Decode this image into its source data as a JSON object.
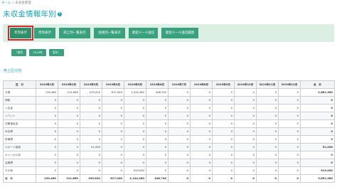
{
  "breadcrumb": {
    "home": "ホーム",
    "current": "未収金管理"
  },
  "page": {
    "title": "未収金情報年別"
  },
  "tabs": [
    {
      "label": "年別表示",
      "active": true
    },
    {
      "label": "月別表示",
      "active": false
    },
    {
      "label": "売上別一覧表示",
      "active": false
    },
    {
      "label": "会員別一覧表示",
      "active": false
    },
    {
      "label": "督促メール送信",
      "active": false
    },
    {
      "label": "督促メール送信履歴",
      "active": false
    }
  ],
  "actions": {
    "btn1": "〈前年",
    "btn2": "2019年",
    "btn3": "翌年〉"
  },
  "section": {
    "label": "売上区分別"
  },
  "table": {
    "headers": [
      "区　分",
      "2019年1月",
      "2019年2月",
      "2019年3月",
      "2019年4月",
      "2019年5月",
      "2019年6月",
      "2019年7月",
      "2019年8月",
      "2019年9月",
      "2019年10月",
      "2019年11月",
      "2019年12月",
      "合　計"
    ],
    "rows": [
      {
        "label": "月謝",
        "cells": [
          "139,460",
          "211,660",
          "239,220",
          "617,040",
          "1,225,260",
          "448,740",
          "0",
          "0",
          "0",
          "0",
          "0",
          "0",
          "2,881,380"
        ]
      },
      {
        "label": "物販",
        "cells": [
          "0",
          "0",
          "0",
          "0",
          "0",
          "0",
          "0",
          "0",
          "0",
          "0",
          "0",
          "0",
          "0"
        ]
      },
      {
        "label": "入会金",
        "cells": [
          "0",
          "0",
          "0",
          "0",
          "0",
          "0",
          "0",
          "0",
          "0",
          "0",
          "0",
          "0",
          "0"
        ]
      },
      {
        "label": "イベント",
        "cells": [
          "0",
          "0",
          "0",
          "0",
          "0",
          "0",
          "0",
          "0",
          "0",
          "0",
          "0",
          "0",
          "0"
        ]
      },
      {
        "label": "在籍保証金",
        "cells": [
          "0",
          "0",
          "0",
          "0",
          "0",
          "0",
          "0",
          "0",
          "0",
          "0",
          "0",
          "0",
          "0"
        ]
      },
      {
        "label": "年会費",
        "cells": [
          "0",
          "0",
          "0",
          "0",
          "0",
          "0",
          "0",
          "0",
          "0",
          "0",
          "0",
          "0",
          "0"
        ]
      },
      {
        "label": "設備費",
        "cells": [
          "0",
          "0",
          "0",
          "0",
          "0",
          "0",
          "0",
          "0",
          "0",
          "0",
          "0",
          "0",
          "0"
        ]
      },
      {
        "label": "スポーツ保険",
        "cells": [
          "0",
          "0",
          "51,000",
          "0",
          "0",
          "0",
          "0",
          "0",
          "0",
          "0",
          "0",
          "0",
          "51,000"
        ]
      },
      {
        "label": "キャンセル料",
        "cells": [
          "0",
          "0",
          "0",
          "0",
          "0",
          "0",
          "0",
          "0",
          "0",
          "0",
          "0",
          "0",
          "0"
        ]
      },
      {
        "label": "会員費",
        "cells": [
          "0",
          "0",
          "0",
          "0",
          "0",
          "0",
          "0",
          "0",
          "0",
          "0",
          "0",
          "0",
          "0"
        ]
      },
      {
        "label": "その他",
        "cells": [
          "0",
          "0",
          "0",
          "0",
          "919,000",
          "0",
          "0",
          "0",
          "0",
          "0",
          "0",
          "0",
          "919,000"
        ]
      }
    ],
    "total": {
      "label": "合　計",
      "cells": [
        "139,460",
        "211,660",
        "290,620",
        "617,040",
        "2,144,260",
        "448,740",
        "0",
        "0",
        "0",
        "0",
        "0",
        "0",
        "3,851,380"
      ]
    }
  }
}
